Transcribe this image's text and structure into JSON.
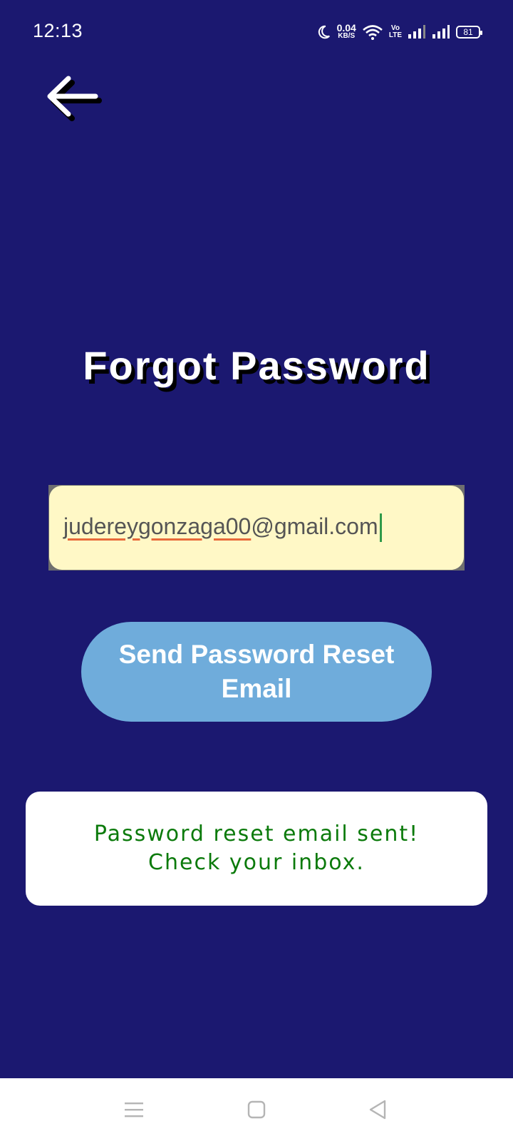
{
  "status_bar": {
    "time": "12:13",
    "net_speed_value": "0.04",
    "net_speed_unit": "KB/S",
    "volte_top": "Vo",
    "volte_bottom": "LTE",
    "battery": "81"
  },
  "page": {
    "title": "Forgot Password"
  },
  "email_field": {
    "value_user": "judereygonzaga00",
    "value_domain": "@gmail.com"
  },
  "send_button": {
    "label": "Send Password Reset Email"
  },
  "message": {
    "text": "Password reset email sent!\nCheck your inbox.",
    "color": "#0B7A0B"
  },
  "colors": {
    "background": "#1B1870",
    "button": "#6FACDB",
    "field": "#FFF8C6"
  },
  "icons": {
    "back": "arrow-left-icon",
    "nav_menu": "menu-icon",
    "nav_home": "home-square-icon",
    "nav_back": "back-triangle-icon"
  }
}
